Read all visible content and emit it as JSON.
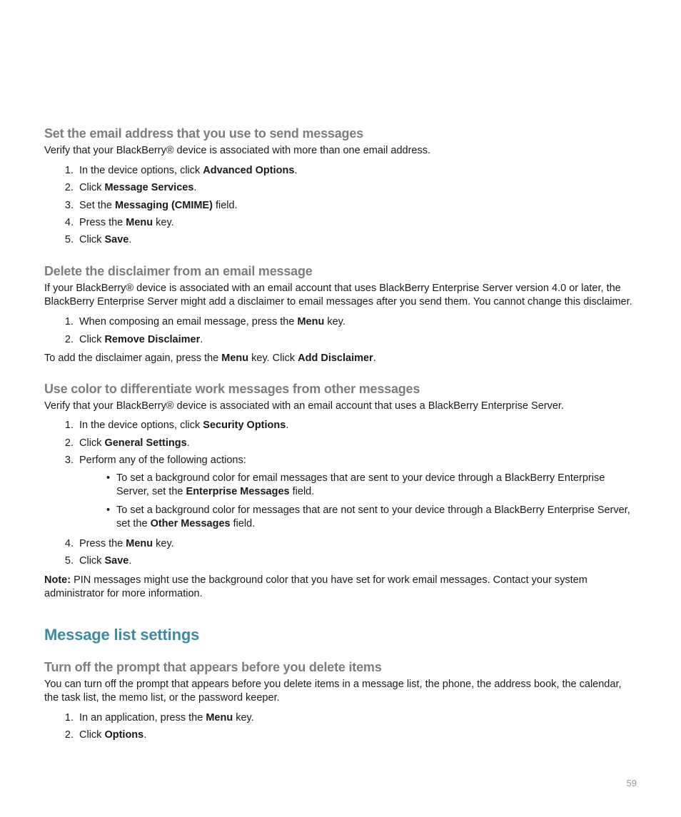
{
  "s1": {
    "h": "Set the email address that you use to send messages",
    "p1a": "Verify that your BlackBerry® device is associated with more than one email address.",
    "l1a": "In the device options, click ",
    "l1b": "Advanced Options",
    "l1c": ".",
    "l2a": "Click ",
    "l2b": "Message Services",
    "l2c": ".",
    "l3a": "Set the ",
    "l3b": "Messaging (CMIME)",
    "l3c": " field.",
    "l4a": "Press the ",
    "l4b": "Menu",
    "l4c": " key.",
    "l5a": "Click ",
    "l5b": "Save",
    "l5c": "."
  },
  "s2": {
    "h": "Delete the disclaimer from an email message",
    "p1": "If your BlackBerry® device is associated with an email account that uses BlackBerry Enterprise Server version 4.0 or later, the BlackBerry Enterprise Server might add a disclaimer to email messages after you send them. You cannot change this disclaimer.",
    "l1a": "When composing an email message, press the ",
    "l1b": "Menu",
    "l1c": " key.",
    "l2a": "Click ",
    "l2b": "Remove Disclaimer",
    "l2c": ".",
    "p2a": "To add the disclaimer again, press the ",
    "p2b": "Menu",
    "p2c": " key. Click ",
    "p2d": "Add Disclaimer",
    "p2e": "."
  },
  "s3": {
    "h": "Use color to differentiate work messages from other messages",
    "p1": "Verify that your BlackBerry® device is associated with an email account that uses a BlackBerry Enterprise Server.",
    "l1a": "In the device options, click ",
    "l1b": "Security Options",
    "l1c": ".",
    "l2a": "Click ",
    "l2b": "General Settings",
    "l2c": ".",
    "l3a": "Perform any of the following actions:",
    "b1a": "To set a background color for email messages that are sent to your device through a BlackBerry Enterprise Server, set the ",
    "b1b": "Enterprise Messages",
    "b1c": " field.",
    "b2a": "To set a background color for messages that are not sent to your device through a BlackBerry Enterprise Server, set the ",
    "b2b": "Other Messages",
    "b2c": " field.",
    "l4a": "Press the ",
    "l4b": "Menu",
    "l4c": " key.",
    "l5a": "Click ",
    "l5b": "Save",
    "l5c": ".",
    "n1a": "Note:",
    "n1b": "  PIN messages might use the background color that you have set for work email messages. Contact your system administrator for more information."
  },
  "sec2": {
    "h": "Message list settings"
  },
  "s4": {
    "h": "Turn off the prompt that appears before you delete items",
    "p1": "You can turn off the prompt that appears before you delete items in a message list, the phone, the address book, the calendar, the task list, the memo list, or the password keeper.",
    "l1a": "In an application, press the ",
    "l1b": "Menu",
    "l1c": " key.",
    "l2a": "Click ",
    "l2b": "Options",
    "l2c": "."
  },
  "pagenum": "59"
}
